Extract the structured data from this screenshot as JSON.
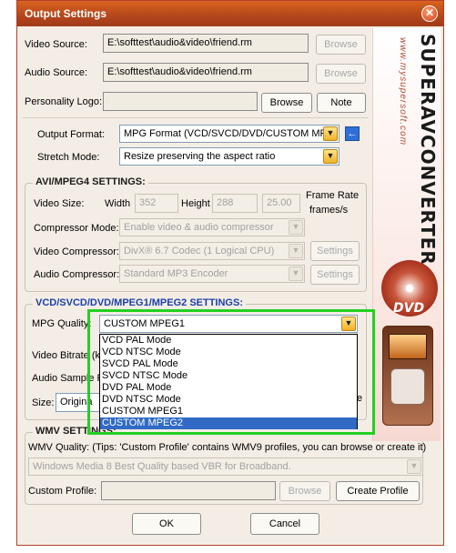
{
  "window": {
    "title": "Output Settings",
    "close": "✕"
  },
  "source": {
    "video_label": "Video Source:",
    "video_value": "E:\\softtest\\audio&video\\friend.rm",
    "audio_label": "Audio Source:",
    "audio_value": "E:\\softtest\\audio&video\\friend.rm",
    "browse": "Browse",
    "logo_label": "Personality Logo:",
    "logo_value": "",
    "note": "Note"
  },
  "output": {
    "format_label": "Output Format:",
    "format_value": "MPG Format (VCD/SVCD/DVD/CUSTOM MPG)",
    "stretch_label": "Stretch Mode:",
    "stretch_value": "Resize preserving the aspect ratio",
    "nav_arrow": "←"
  },
  "avi": {
    "title": "AVI/MPEG4 SETTINGS:",
    "video_size_label": "Video Size:",
    "width_label": "Width",
    "width_value": "352",
    "height_label": "Height",
    "height_value": "288",
    "fps_value": "25.00",
    "fps_label_1": "Frame Rate",
    "fps_label_2": "frames/s",
    "compressor_mode_label": "Compressor Mode:",
    "compressor_mode_value": "Enable video & audio compressor",
    "video_compressor_label": "Video Compressor:",
    "video_compressor_value": "DivX® 6.7 Codec (1 Logical CPU)",
    "audio_compressor_label": "Audio Compressor:",
    "audio_compressor_value": "Standard MP3 Encoder",
    "settings": "Settings"
  },
  "mpeg": {
    "title": "VCD/SVCD/DVD/MPEG1/MPEG2 SETTINGS:",
    "quality_label": "MPG Quality:",
    "quality_value": "CUSTOM MPEG1",
    "bitrate_label": "Video Bitrate (kb",
    "sample_label": "Audio Sample R",
    "size_label": "Size:",
    "size_value": "Origina",
    "size_tail": "e",
    "options": [
      "VCD PAL Mode",
      "VCD NTSC Mode",
      "SVCD PAL Mode",
      "SVCD NTSC Mode",
      "DVD PAL Mode",
      "DVD NTSC Mode",
      "CUSTOM MPEG1",
      "CUSTOM MPEG2"
    ]
  },
  "wmv": {
    "title": "WMV SETTINGS:",
    "quality_label": "WMV Quality: (Tips: 'Custom Profile' contains WMV9 profiles, you can browse or create it)",
    "quality_value": "Windows Media 8 Best Quality based VBR for Broadband.",
    "custom_label": "Custom Profile:",
    "custom_value": "",
    "browse": "Browse",
    "create": "Create Profile"
  },
  "footer": {
    "ok": "OK",
    "cancel": "Cancel"
  },
  "sidebar": {
    "brand": "SUPERAVCONVERTER",
    "website": "www.mysupersoft.com",
    "dvd": "DVD"
  },
  "colors": {
    "titlebar": "#b3461a",
    "highlight": "#22d022",
    "selection": "#316ac5"
  }
}
